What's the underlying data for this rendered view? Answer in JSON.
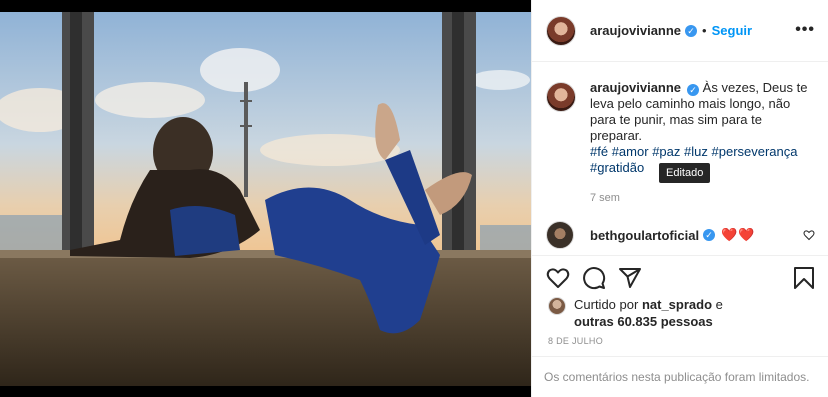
{
  "post": {
    "author": "araujovivianne",
    "verified_mark": "✓",
    "separator": "•",
    "follow_label": "Seguir",
    "more_label": "•••",
    "caption": "Às vezes, Deus te leva pelo caminho mais longo, não para te punir, mas sim para te preparar.",
    "hashtags": [
      "#fé",
      "#amor",
      "#paz",
      "#luz",
      "#perseverança",
      "#gratidão"
    ],
    "tooltip": "Editado",
    "time_ago": "7 sem"
  },
  "comment": {
    "author": "bethgoulartoficial",
    "verified_mark": "✓",
    "text": "❤️❤️"
  },
  "likes": {
    "prefix": "Curtido por",
    "user": "nat_sprado",
    "mid": "e",
    "others": "outras 60.835 pessoas"
  },
  "date": "8 DE JULHO",
  "footer": "Os comentários nesta publicação foram limitados.",
  "icons": {
    "like": "heart-icon",
    "comment": "comment-icon",
    "share": "share-icon",
    "save": "bookmark-icon",
    "more": "more-options-icon"
  },
  "colors": {
    "link": "#0095f6",
    "hashtag": "#00376b",
    "muted": "#8e8e8e",
    "heart": "#ed4956"
  }
}
